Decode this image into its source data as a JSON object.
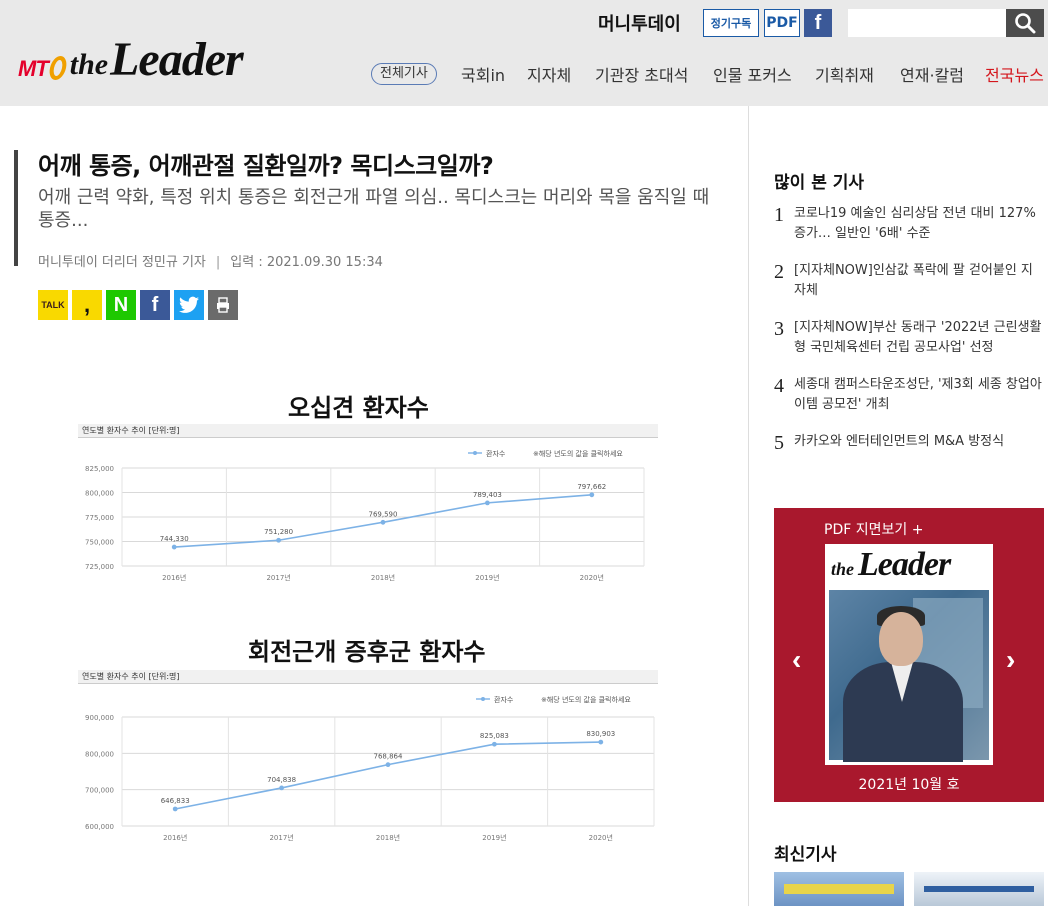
{
  "header": {
    "logo": {
      "mt": "MT",
      "the": "the",
      "leader": "Leader"
    },
    "brand": "머니투데이",
    "subscribe_label": "정기구독",
    "pdf_label": "PDF",
    "facebook_icon": "facebook-icon",
    "search": {
      "placeholder": "",
      "icon": "search-icon"
    }
  },
  "nav": {
    "items": [
      {
        "label": "전체기사",
        "active": true
      },
      {
        "label": "국회in"
      },
      {
        "label": "지자체"
      },
      {
        "label": "기관장 초대석"
      },
      {
        "label": "인물 포커스"
      },
      {
        "label": "기획취재"
      },
      {
        "label": "연재·칼럼"
      },
      {
        "label": "전국뉴스",
        "color": "#d4161d"
      }
    ]
  },
  "article": {
    "title": "어깨 통증, 어깨관절 질환일까? 목디스크일까?",
    "subtitle": "어깨 근력 약화, 특정 위치 통증은 회전근개 파열 의심.. 목디스크는 머리와 목을 움직일 때 통증...",
    "byline": "머니투데이 더리더 정민규 기자",
    "date_label": "입력 : 2021.09.30 15:34",
    "share": {
      "kakao": "TALK",
      "story": ",",
      "naver": "N",
      "facebook": "f",
      "twitter": "twitter-bird-icon",
      "print": "print-icon"
    }
  },
  "chart_data": [
    {
      "type": "line",
      "title": "오십견 환자수",
      "subtitle": "연도별 환자수 추이 [단위:명]",
      "legend": "환자수",
      "note": "※해당 년도의 값을 클릭하세요",
      "categories": [
        "2016년",
        "2017년",
        "2018년",
        "2019년",
        "2020년"
      ],
      "values": [
        744330,
        751280,
        769590,
        789403,
        797662
      ],
      "value_labels": [
        "744,330",
        "751,280",
        "769,590",
        "789,403",
        "797,662"
      ],
      "ylim": [
        725000,
        825000
      ],
      "yticks": [
        "825,000",
        "800,000",
        "775,000",
        "750,000",
        "725,000"
      ],
      "ytick_values": [
        825000,
        800000,
        775000,
        750000,
        725000
      ],
      "color": "#7db2e6",
      "grid": true
    },
    {
      "type": "line",
      "title": "회전근개 증후군 환자수",
      "subtitle": "연도별 환자수 추이 [단위:명]",
      "legend": "환자수",
      "note": "※해당 년도의 값을 클릭하세요",
      "categories": [
        "2016년",
        "2017년",
        "2018년",
        "2019년",
        "2020년"
      ],
      "values": [
        646833,
        704838,
        768864,
        825083,
        830903
      ],
      "value_labels": [
        "646,833",
        "704,838",
        "768,864",
        "825,083",
        "830,903"
      ],
      "ylim": [
        600000,
        900000
      ],
      "yticks": [
        "900,000",
        "800,000",
        "700,000",
        "600,000"
      ],
      "ytick_values": [
        900000,
        800000,
        700000,
        600000
      ],
      "color": "#7db2e6",
      "grid": true
    }
  ],
  "sidebar": {
    "popular_title": "많이 본 기사",
    "popular": [
      {
        "num": "1",
        "text": "코로나19 예술인 심리상담 전년 대비 127% 증가… 일반인 '6배' 수준"
      },
      {
        "num": "2",
        "text": "[지자체NOW]인삼값 폭락에 팔 걷어붙인 지자체"
      },
      {
        "num": "3",
        "text": "[지자체NOW]부산 동래구 '2022년 근린생활형 국민체육센터 건립 공모사업' 선정"
      },
      {
        "num": "4",
        "text": "세종대 캠퍼스타운조성단, '제3회 세종 창업아이템 공모전' 개최"
      },
      {
        "num": "5",
        "text": "카카오와 엔터테인먼트의 M&A 방정식"
      }
    ],
    "pdf": {
      "label": "PDF 지면보기 +",
      "cover_the": "the",
      "cover_leader": "Leader",
      "issue": "2021년 10월 호",
      "prev_icon": "chevron-left-icon",
      "next_icon": "chevron-right-icon"
    },
    "latest_title": "최신기사"
  }
}
